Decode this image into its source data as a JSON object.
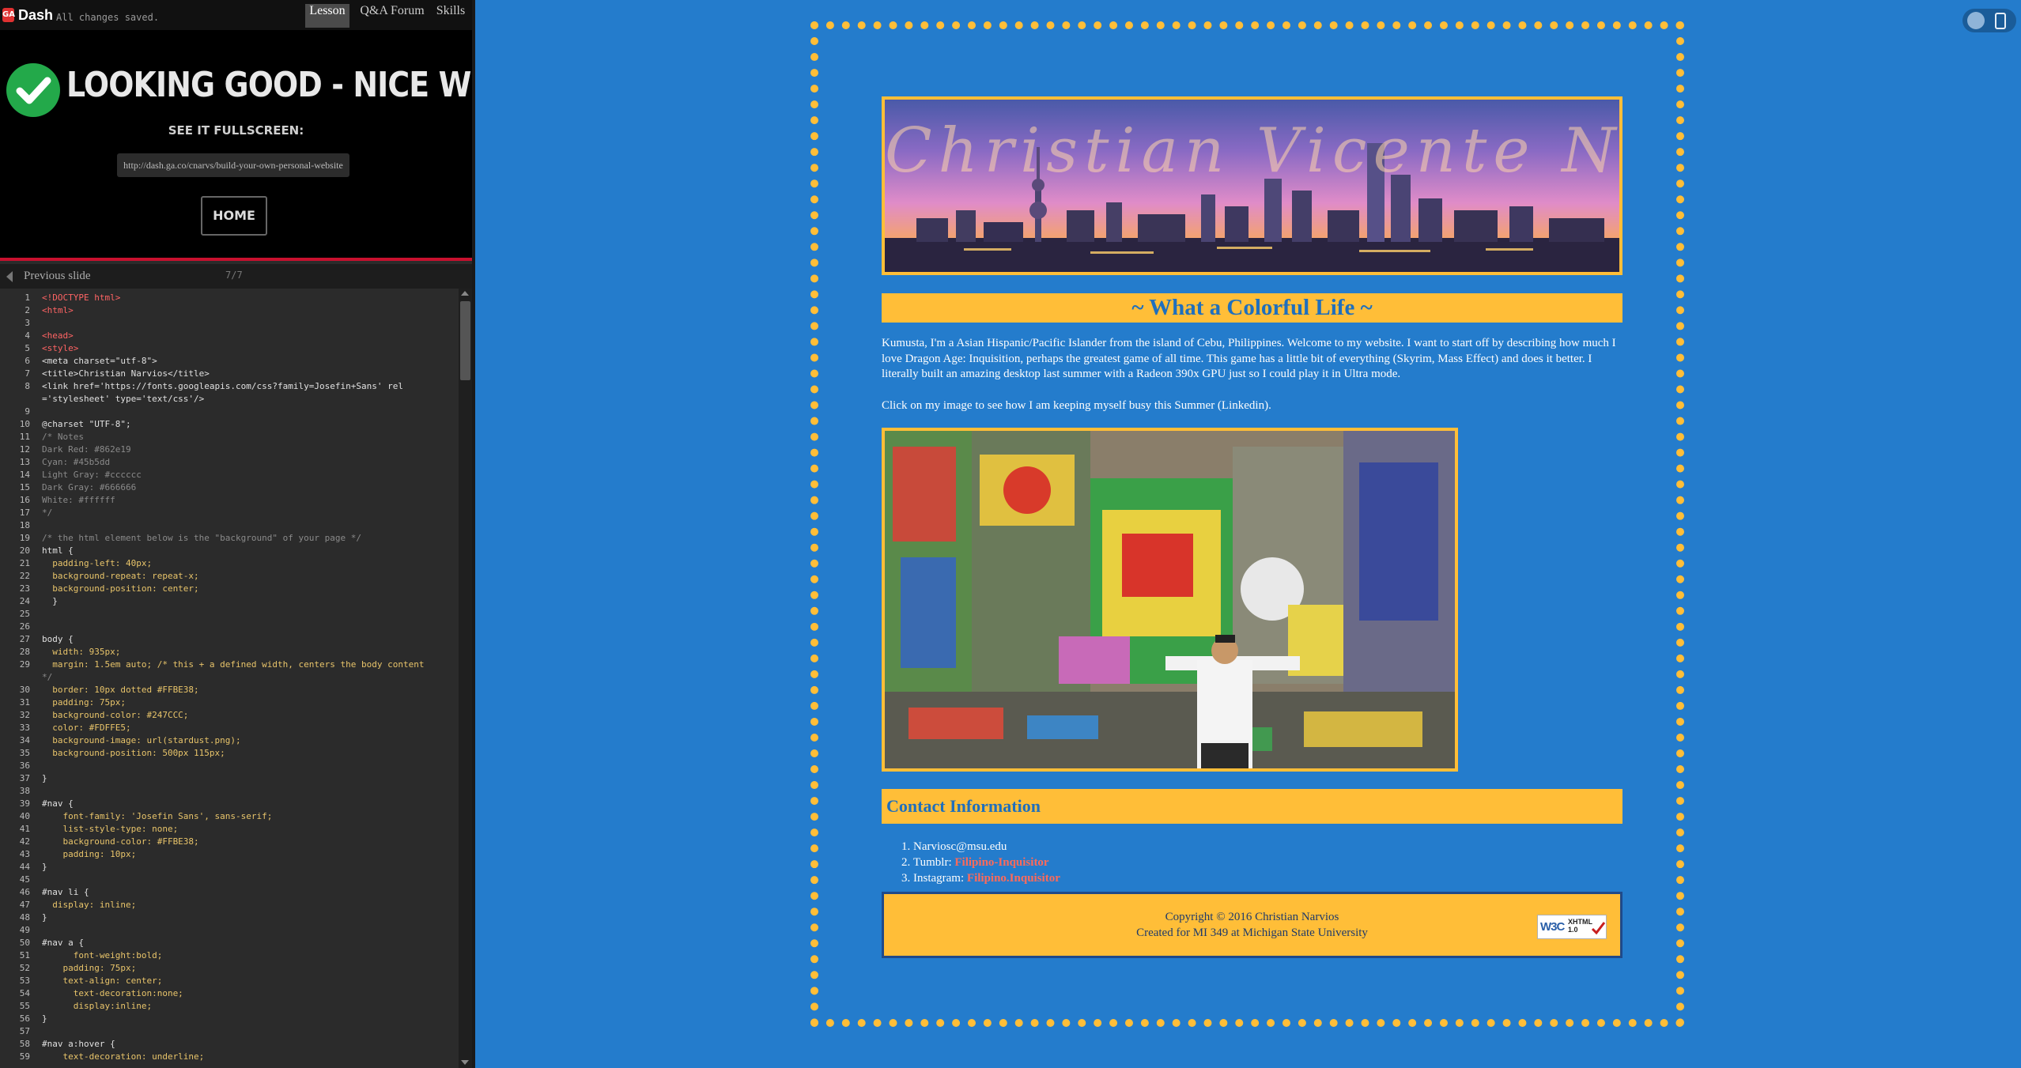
{
  "topbar": {
    "logo_text": "GA",
    "app_name": "Dash",
    "save_status": "All changes saved.",
    "tabs": {
      "lesson": "Lesson",
      "forum": "Q&A Forum",
      "skills": "Skills"
    }
  },
  "lesson": {
    "heading": "LOOKING GOOD - NICE WORK!",
    "fullscreen_label": "SEE IT FULLSCREEN:",
    "url": "http://dash.ga.co/cnarvs/build-your-own-personal-website",
    "home_button": "HOME"
  },
  "slide_nav": {
    "previous_label": "Previous slide",
    "counter": "7/7"
  },
  "code_lines": [
    {
      "n": "1",
      "t": "<!DOCTYPE html>"
    },
    {
      "n": "2",
      "t": "<html>"
    },
    {
      "n": "3",
      "t": ""
    },
    {
      "n": "4",
      "t": "<head>"
    },
    {
      "n": "5",
      "t": "<style>"
    },
    {
      "n": "6",
      "t": "<meta charset=\"utf-8\">"
    },
    {
      "n": "7",
      "t": "<title>Christian Narvios</title>"
    },
    {
      "n": "8",
      "t": "<link href='https://fonts.googleapis.com/css?family=Josefin+Sans' rel"
    },
    {
      "n": "",
      "t": "='stylesheet' type='text/css'/>"
    },
    {
      "n": "9",
      "t": ""
    },
    {
      "n": "10",
      "t": "@charset \"UTF-8\";"
    },
    {
      "n": "11",
      "t": "/* Notes"
    },
    {
      "n": "12",
      "t": "Dark Red: #862e19"
    },
    {
      "n": "13",
      "t": "Cyan: #45b5dd"
    },
    {
      "n": "14",
      "t": "Light Gray: #cccccc"
    },
    {
      "n": "15",
      "t": "Dark Gray: #666666"
    },
    {
      "n": "16",
      "t": "White: #ffffff"
    },
    {
      "n": "17",
      "t": "*/"
    },
    {
      "n": "18",
      "t": ""
    },
    {
      "n": "19",
      "t": "/* the html element below is the \"background\" of your page */"
    },
    {
      "n": "20",
      "t": "html {"
    },
    {
      "n": "21",
      "t": "  padding-left: 40px;"
    },
    {
      "n": "22",
      "t": "  background-repeat: repeat-x;"
    },
    {
      "n": "23",
      "t": "  background-position: center;"
    },
    {
      "n": "24",
      "t": "  }"
    },
    {
      "n": "25",
      "t": ""
    },
    {
      "n": "26",
      "t": ""
    },
    {
      "n": "27",
      "t": "body {"
    },
    {
      "n": "28",
      "t": "  width: 935px;"
    },
    {
      "n": "29",
      "t": "  margin: 1.5em auto; /* this + a defined width, centers the body content"
    },
    {
      "n": "",
      "t": "*/"
    },
    {
      "n": "30",
      "t": "  border: 10px dotted #FFBE38;"
    },
    {
      "n": "31",
      "t": "  padding: 75px;"
    },
    {
      "n": "32",
      "t": "  background-color: #247CCC;"
    },
    {
      "n": "33",
      "t": "  color: #FDFFE5;"
    },
    {
      "n": "34",
      "t": "  background-image: url(stardust.png);"
    },
    {
      "n": "35",
      "t": "  background-position: 500px 115px;"
    },
    {
      "n": "36",
      "t": ""
    },
    {
      "n": "37",
      "t": "}"
    },
    {
      "n": "38",
      "t": ""
    },
    {
      "n": "39",
      "t": "#nav {"
    },
    {
      "n": "40",
      "t": "    font-family: 'Josefin Sans', sans-serif;"
    },
    {
      "n": "41",
      "t": "    list-style-type: none;"
    },
    {
      "n": "42",
      "t": "    background-color: #FFBE38;"
    },
    {
      "n": "43",
      "t": "    padding: 10px;"
    },
    {
      "n": "44",
      "t": "}"
    },
    {
      "n": "45",
      "t": ""
    },
    {
      "n": "46",
      "t": "#nav li {"
    },
    {
      "n": "47",
      "t": "  display: inline;"
    },
    {
      "n": "48",
      "t": "}"
    },
    {
      "n": "49",
      "t": ""
    },
    {
      "n": "50",
      "t": "#nav a {"
    },
    {
      "n": "51",
      "t": "      font-weight:bold;"
    },
    {
      "n": "52",
      "t": "    padding: 75px;"
    },
    {
      "n": "53",
      "t": "    text-align: center;"
    },
    {
      "n": "54",
      "t": "      text-decoration:none;"
    },
    {
      "n": "55",
      "t": "      display:inline;"
    },
    {
      "n": "56",
      "t": "}"
    },
    {
      "n": "57",
      "t": ""
    },
    {
      "n": "58",
      "t": "#nav a:hover {"
    },
    {
      "n": "59",
      "t": "    text-decoration: underline;"
    }
  ],
  "preview": {
    "banner_name": "Christian Vicente Narvios",
    "tagline": "~ What a Colorful Life ~",
    "intro": "Kumusta, I'm a Asian Hispanic/Pacific Islander from the island of Cebu, Philippines. Welcome to my website. I want to start off by describing how much I love Dragon Age: Inquisition, perhaps the greatest game of all time. This game has a little bit of everything (Skyrim, Mass Effect) and does it better. I literally built an amazing desktop last summer with a Radeon 390x GPU just so I could play it in Ultra mode.",
    "click_text": "Click on my image to see how I am keeping myself busy this Summer (Linkedin).",
    "contact_heading": "Contact Information",
    "contacts": {
      "email": "Narviosc@msu.edu",
      "tumblr_label": "Tumblr: ",
      "tumblr_link": "Filipino-Inquisitor",
      "instagram_label": "Instagram: ",
      "instagram_link": "Filipino.Inquisitor"
    },
    "footer": {
      "copyright": "Copyright © 2016 Christian Narvios",
      "credit": "Created for MI 349 at Michigan State University",
      "badge_w3c": "W3C",
      "badge_xhtml": "XHTML",
      "badge_version": "1.0"
    }
  },
  "colors": {
    "body_background": "#247ccc",
    "accent_yellow": "#ffbe38",
    "link_salmon": "#ff6a5a",
    "error_red_bar": "#c8102e",
    "check_green": "#23a94a"
  },
  "icons": [
    "check-circle-icon",
    "previous-arrow-icon",
    "desktop-view-icon",
    "mobile-view-icon",
    "w3c-check-icon"
  ]
}
